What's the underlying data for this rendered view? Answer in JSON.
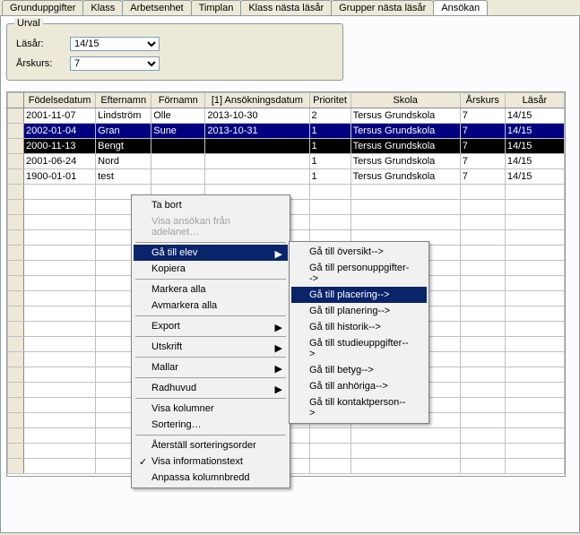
{
  "tabs": {
    "t0": "Grunduppgifter",
    "t1": "Klass",
    "t2": "Arbetsenhet",
    "t3": "Timplan",
    "t4": "Klass nästa läsår",
    "t5": "Grupper nästa läsår",
    "t6": "Ansökan"
  },
  "urval": {
    "legend": "Urval",
    "lasar_label": "Läsår:",
    "lasar_value": "14/15",
    "arskurs_label": "Årskurs:",
    "arskurs_value": "7"
  },
  "grid": {
    "headers": {
      "fodelsedatum": "Födelsedatum",
      "efternamn": "Efternamn",
      "fornamn": "Förnamn",
      "ansokningsdatum": "[1] Ansökningsdatum",
      "prioritet": "Prioritet",
      "skola": "Skola",
      "arskurs": "Årskurs",
      "lasar": "Läsår"
    },
    "rows": [
      {
        "f": "2001-11-07",
        "e": "Lindström",
        "n": "Olle",
        "a": "2013-10-30",
        "p": "2",
        "s": "Tersus Grundskola",
        "ak": "7",
        "l": "14/15"
      },
      {
        "f": "2002-01-04",
        "e": "Gran",
        "n": "Sune",
        "a": "2013-10-31",
        "p": "1",
        "s": "Tersus Grundskola",
        "ak": "7",
        "l": "14/15"
      },
      {
        "f": "2000-11-13",
        "e": "Bengt",
        "n": "",
        "a": "",
        "p": "1",
        "s": "Tersus Grundskola",
        "ak": "7",
        "l": "14/15"
      },
      {
        "f": "2001-06-24",
        "e": "Nord",
        "n": "",
        "a": "",
        "p": "1",
        "s": "Tersus Grundskola",
        "ak": "7",
        "l": "14/15"
      },
      {
        "f": "1900-01-01",
        "e": "test",
        "n": "",
        "a": "",
        "p": "1",
        "s": "Tersus Grundskola",
        "ak": "7",
        "l": "14/15"
      }
    ]
  },
  "ctx": {
    "ta_bort": "Ta bort",
    "visa_ansokan": "Visa ansökan från adelanet…",
    "ga_till_elev": "Gå till elev",
    "kopiera": "Kopiera",
    "markera_alla": "Markera alla",
    "avmarkera_alla": "Avmarkera alla",
    "export": "Export",
    "utskrift": "Utskrift",
    "mallar": "Mallar",
    "radhuvud": "Radhuvud",
    "visa_kolumner": "Visa kolumner",
    "sortering": "Sortering…",
    "aterstall": "Återställ sorteringsorder",
    "visa_info": "Visa informationstext",
    "anpassa": "Anpassa kolumnbredd"
  },
  "sub": {
    "oversikt": "Gå till översikt-->",
    "personuppgifter": "Gå till personuppgifter-->",
    "placering": "Gå till placering-->",
    "planering": "Gå till planering-->",
    "historik": "Gå till historik-->",
    "studieuppgifter": "Gå till studieuppgifter-->",
    "betyg": "Gå till betyg-->",
    "anhoriga": "Gå till anhöriga-->",
    "kontaktperson": "Gå till kontaktperson-->"
  }
}
